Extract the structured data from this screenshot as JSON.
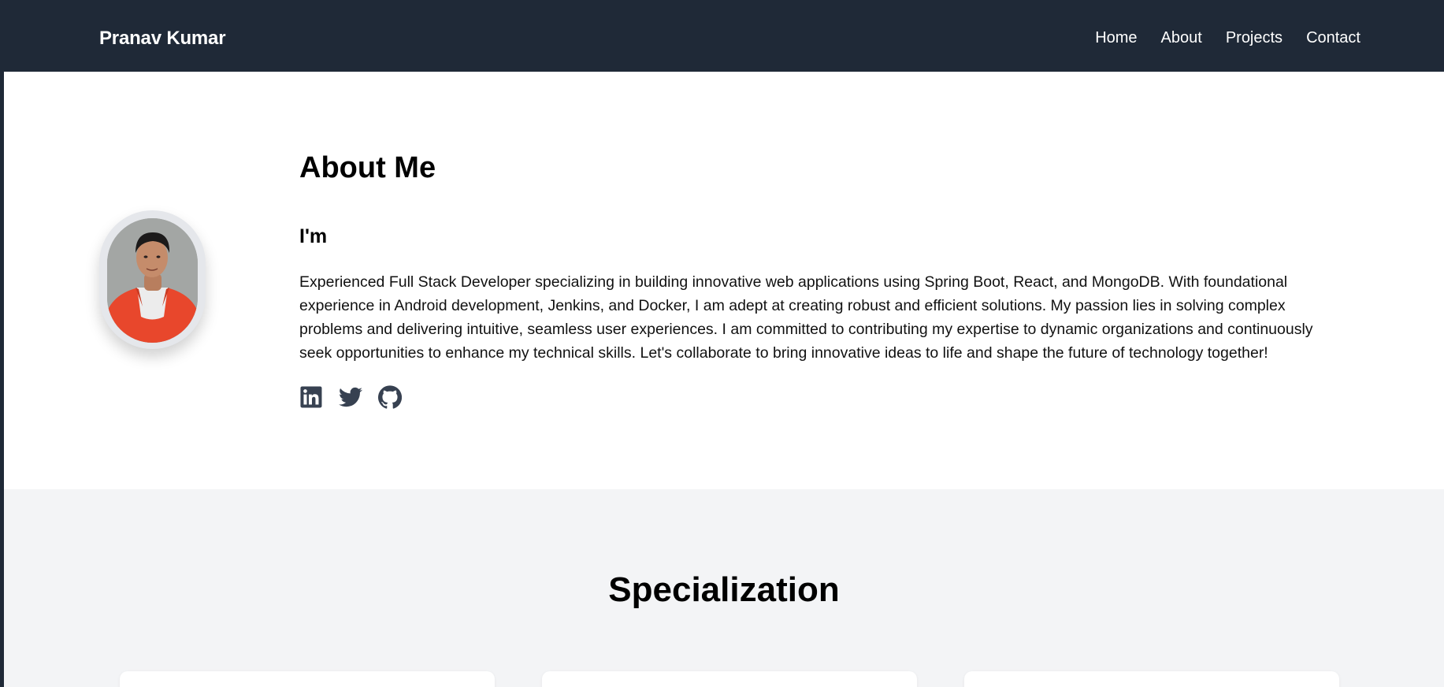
{
  "navbar": {
    "brand": "Pranav Kumar",
    "links": [
      "Home",
      "About",
      "Projects",
      "Contact"
    ]
  },
  "about": {
    "title": "About Me",
    "subtitle": "I'm",
    "text": "Experienced Full Stack Developer specializing in building innovative web applications using Spring Boot, React, and MongoDB. With foundational experience in Android development, Jenkins, and Docker, I am adept at creating robust and efficient solutions. My passion lies in solving complex problems and delivering intuitive, seamless user experiences. I am committed to contributing my expertise to dynamic organizations and continuously seek opportunities to enhance my technical skills. Let's collaborate to bring innovative ideas to life and shape the future of technology together!",
    "socials": [
      "linkedin-icon",
      "twitter-icon",
      "github-icon"
    ]
  },
  "specialization": {
    "title": "Specialization"
  },
  "colors": {
    "navbar_bg": "#1f2937",
    "section_alt_bg": "#f3f4f6",
    "icon": "#374151"
  }
}
